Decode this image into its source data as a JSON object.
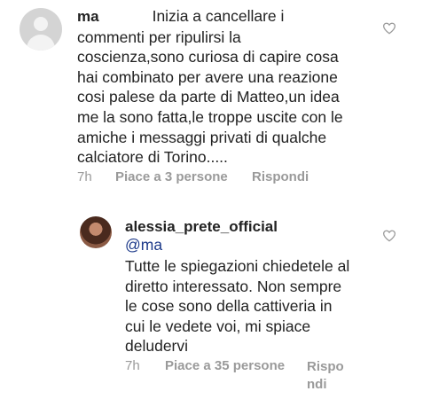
{
  "comment1": {
    "username": "ma",
    "text": "Inizia a cancellare i\ncommenti per ripulirsi la\ncoscienza,sono curiosa di capire cosa\nhai combinato per avere una reazione\ncosi palese da parte di Matteo,un idea\nme la sono fatta,le troppe uscite con le\namiche i messaggi privati di qualche\ncalciatore di Torino.....",
    "time": "7h",
    "likes": "Piace a 3 persone",
    "reply": "Rispondi"
  },
  "comment2": {
    "username": "alessia_prete_official",
    "mention": "@ma",
    "text": "Tutte le spiegazioni chiedetele al\ndiretto interessato. Non sempre\nle cose sono della cattiveria in\ncui le vedete voi, mi spiace\ndeludervi",
    "time": "7h",
    "likes": "Piace a 35 persone",
    "reply": "Rispo\nndi"
  },
  "icons": {
    "like": "heart-outline-icon",
    "avatar_placeholder": "default-avatar-icon"
  }
}
